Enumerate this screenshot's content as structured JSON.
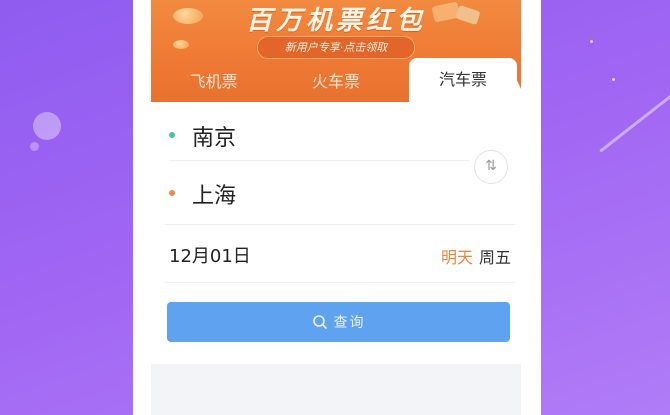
{
  "banner": {
    "title": "百万机票红包",
    "subtitle": "新用户专享·点击领取"
  },
  "tabs": [
    {
      "label": "飞机票",
      "active": false
    },
    {
      "label": "火车票",
      "active": false
    },
    {
      "label": "汽车票",
      "active": true
    }
  ],
  "route": {
    "from": "南京",
    "to": "上海",
    "swap_icon": "swap-vertical-icon"
  },
  "date": {
    "value": "12月01日",
    "relative": "明天",
    "weekday": "周五"
  },
  "search": {
    "label": "查询",
    "icon": "search-icon"
  },
  "colors": {
    "banner": "#ef7a34",
    "accent_orange": "#f0843a",
    "from_dot": "#4cc29a",
    "to_dot": "#f08a3e",
    "button": "#5fa2ef",
    "background_purple": "#a065f3"
  }
}
